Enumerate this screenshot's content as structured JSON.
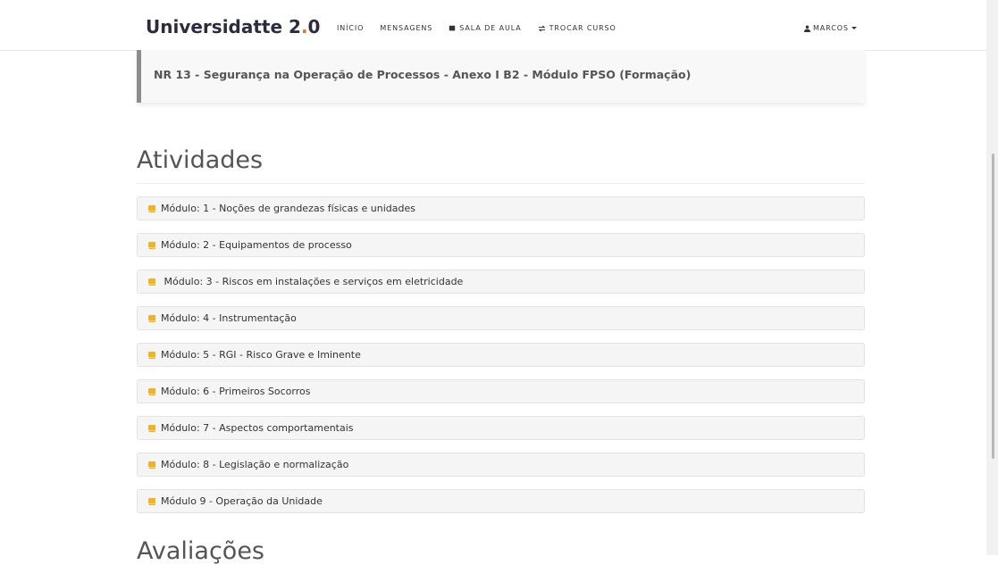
{
  "brand": {
    "name": "Universidatte 2",
    "dot": ".",
    "suffix": "0"
  },
  "nav": {
    "inicio": "INÍCIO",
    "mensagens": "MENSAGENS",
    "sala": "SALA DE AULA",
    "trocar": "TROCAR CURSO",
    "user": "MARCOS"
  },
  "course": {
    "title": "NR 13 - Segurança na Operação de Processos - Anexo I B2 - Módulo FPSO (Formação)"
  },
  "sections": {
    "atividades": "Atividades",
    "avaliacoes": "Avaliações"
  },
  "modules": [
    "Módulo: 1 - Noções de grandezas físicas e unidades",
    "Módulo: 2 - Equipamentos de processo",
    " Módulo: 3 - Riscos em instalações e serviços em eletricidade",
    "Módulo: 4 - Instrumentação",
    "Módulo: 5 - RGI - Risco Grave e Iminente",
    "Módulo: 6 - Primeiros Socorros",
    "Módulo: 7 - Aspectos comportamentais",
    "Módulo: 8 - Legislação e normalização",
    "Módulo 9 - Operação da Unidade"
  ],
  "colors": {
    "accent": "#e8742a",
    "module_icon": "#f0b323",
    "brand_text": "#2b2d3e"
  },
  "icons": {
    "sala": "book-icon",
    "trocar": "exchange-icon",
    "user": "user-icon",
    "caret": "caret-down-icon",
    "module": "book-icon"
  }
}
